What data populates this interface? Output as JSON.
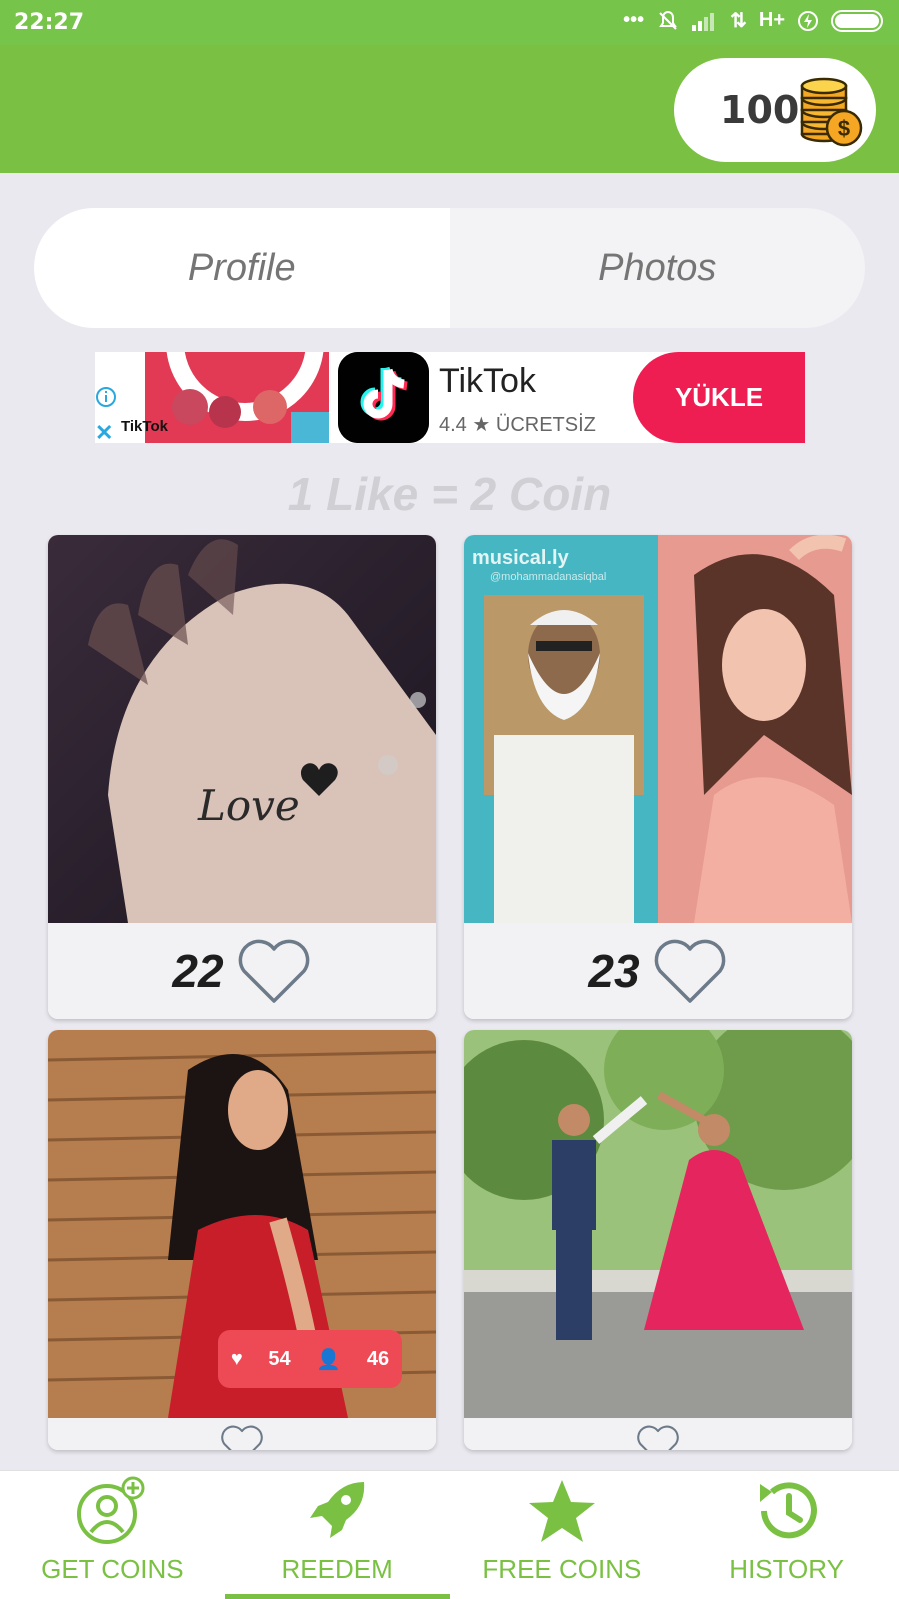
{
  "status_bar": {
    "time": "22:27",
    "network": "H+"
  },
  "header": {
    "coin_balance": "100",
    "coin_icon": "coin-stack-icon"
  },
  "tabs": [
    {
      "label": "Profile",
      "active": true
    },
    {
      "label": "Photos",
      "active": false
    }
  ],
  "ad": {
    "app_name": "TikTok",
    "rating": "4.4",
    "price": "ÜCRETSİZ",
    "install_label": "YÜKLE",
    "thumb_text": "TikTok"
  },
  "rate_text": "1 Like = 2 Coin",
  "photos": [
    {
      "likes": "22",
      "overlay_text": ""
    },
    {
      "likes": "23",
      "overlay_text": "musical.ly",
      "overlay_handle": "@mohammadanasiqbal"
    },
    {
      "likes": "",
      "overlay_likes": "54",
      "overlay_followers": "46"
    },
    {
      "likes": ""
    }
  ],
  "bottom_nav": [
    {
      "label": "GET COINS",
      "icon": "user-add-icon",
      "active": false
    },
    {
      "label": "REEDEM",
      "icon": "rocket-icon",
      "active": true
    },
    {
      "label": "FREE COINS",
      "icon": "star-icon",
      "active": false
    },
    {
      "label": "HISTORY",
      "icon": "history-icon",
      "active": false
    }
  ],
  "colors": {
    "accent": "#7ac143",
    "tiktok_red": "#ee1d52",
    "background": "#e9e9ef"
  }
}
